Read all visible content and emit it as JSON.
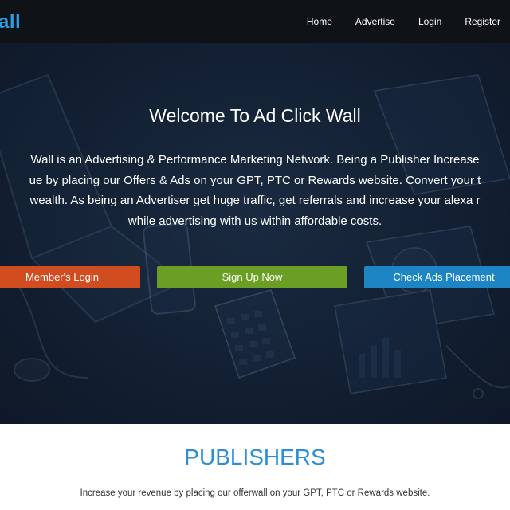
{
  "navbar": {
    "logo_text": "all",
    "links": [
      "Home",
      "Advertise",
      "Login",
      "Register"
    ]
  },
  "hero": {
    "title": "Welcome To Ad Click Wall",
    "paragraph_lines": [
      "Wall is an Advertising & Performance Marketing Network. Being a Publisher Increase",
      "ue by placing our Offers & Ads on your GPT, PTC or Rewards website. Convert your t",
      "wealth. As being an Advertiser get huge traffic, get referrals and increase your alexa r",
      "while advertising with us within affordable costs."
    ],
    "buttons": {
      "members_login": "Member's Login",
      "sign_up": "Sign Up Now",
      "check_ads": "Check Ads Placement"
    }
  },
  "publishers": {
    "title": "PUBLISHERS",
    "text": "Increase your revenue by placing our offerwall on your GPT, PTC or Rewards website."
  },
  "colors": {
    "navbar_bg": "#0f1318",
    "logo": "#2e9be3",
    "hero_bg": "#132033",
    "login_button": "#d14c1f",
    "signup_button": "#6a9f24",
    "check_button": "#1e85c4",
    "publishers_title": "#2b8ed6"
  }
}
